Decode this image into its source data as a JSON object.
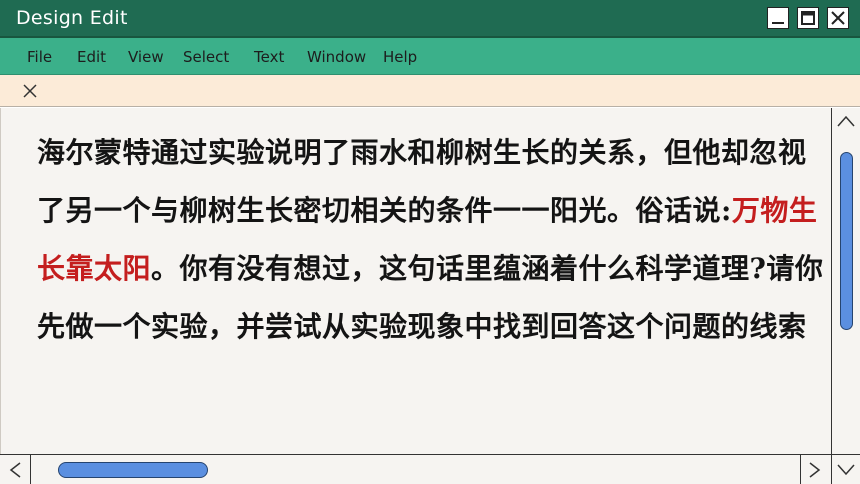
{
  "window": {
    "title": "Design Edit",
    "controls": [
      {
        "name": "minimize",
        "icon": "minimize-icon"
      },
      {
        "name": "maximize",
        "icon": "maximize-icon"
      },
      {
        "name": "close",
        "icon": "close-icon"
      }
    ]
  },
  "menu": {
    "items": [
      "File",
      "Edit",
      "View",
      "Select",
      "Text",
      "Window",
      "Help"
    ]
  },
  "tabbar": {
    "close_icon": "close-x-icon"
  },
  "document": {
    "text_before": "海尔蒙特通过实验说明了雨水和柳树生长的关系，但他却忽视了另一个与柳树生长密切相关的条件一一阳光。俗话说:",
    "highlight": "万物生长靠太阳",
    "text_after": "。你有没有想过，这句话里蕴涵着什么科学道理?请你先做一个实验，并尝试从实验现象中找到回答这个问题的线索",
    "highlight_color": "#c41e1e"
  },
  "scrollbars": {
    "vertical": {
      "up_icon": "chevron-up-icon",
      "down_icon": "chevron-down-icon"
    },
    "horizontal": {
      "left_icon": "chevron-left-icon",
      "right_icon": "chevron-right-icon"
    }
  },
  "colors": {
    "titlebar": "#1f6b52",
    "menubar": "#3bb08a",
    "tabbar": "#fcebd8",
    "content": "#f6f4f1",
    "scroll_thumb": "#5b8fe0"
  }
}
